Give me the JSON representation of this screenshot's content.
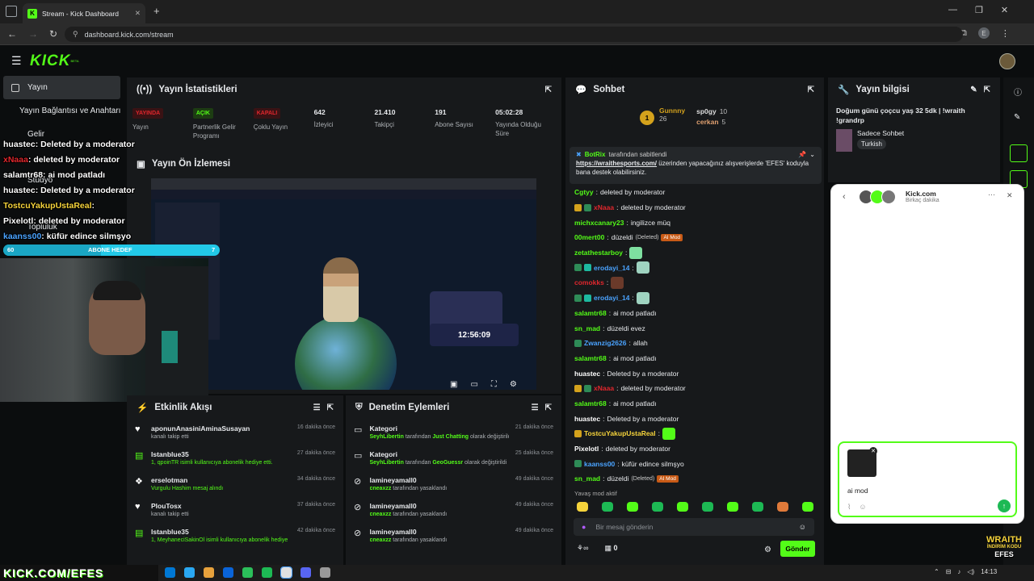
{
  "browser": {
    "tab_title": "Stream - Kick Dashboard",
    "url": "dashboard.kick.com/stream",
    "profile_initial": "E"
  },
  "nav": {
    "logo": "KICK",
    "logo_sup": "BETA"
  },
  "sidebar": {
    "items": [
      {
        "label": "Yayın"
      },
      {
        "label": "Yayın Bağlantısı ve Anahtarı"
      },
      {
        "label": "Gelir"
      },
      {
        "label": "Stüdyo"
      },
      {
        "label": "Topluluk"
      }
    ]
  },
  "stats": {
    "title": "Yayın İstatistikleri",
    "items": [
      {
        "badge": "YAYINDA",
        "label": "Yayın",
        "badge_color": "#e0272d"
      },
      {
        "badge": "AÇIK",
        "label": "Partnerlik Gelir Programı",
        "badge_color": "#53fc18"
      },
      {
        "badge": "KAPALI",
        "label": "Çoklu Yayın",
        "badge_color": "#e0272d"
      },
      {
        "value": "642",
        "label": "İzleyici"
      },
      {
        "value": "21.410",
        "label": "Takipçi"
      },
      {
        "value": "191",
        "label": "Abone Sayısı"
      },
      {
        "value": "05:02:28",
        "label": "Yayında Olduğu Süre"
      }
    ]
  },
  "preview": {
    "title": "Yayın Ön İzlemesi",
    "card_time": "12:56:09",
    "card_title": "Sadece Sohbet"
  },
  "overlay": {
    "lines": [
      {
        "name": "huastec",
        "text": ": Deleted by a moderator"
      },
      {
        "name": "xNaaa",
        "text": ": deleted by moderator"
      },
      {
        "name": "salamtr68",
        "text": ": ai mod patladı"
      },
      {
        "name": "huastec",
        "text": ": Deleted by a moderator"
      },
      {
        "name": "TostcuYakupUstaReal",
        "text": ":"
      },
      {
        "name": "Pixelotl",
        "text": ": deleted by moderator"
      },
      {
        "name": "kaanss00",
        "text": ": küfür edince silmşyo"
      }
    ],
    "goal_left": "60",
    "goal_label": "ABONE HEDEF",
    "goal_right": "7",
    "goal_progress": 0.45,
    "footer_text": "KICK.COM/EFES",
    "wraith_lines": [
      "WRAITH",
      "İNDİRİM KODU",
      "EFES"
    ]
  },
  "activity": {
    "title": "Etkinlik Akışı",
    "items": [
      {
        "icon": "heart-icon",
        "user": "aponunAnasiniAminaSusayan",
        "sub": "kanalı takip etti",
        "time": "16 dakika önce"
      },
      {
        "icon": "gift-icon",
        "user": "Istanblue35",
        "sub": "1, qpoinTR isimli kullanıcıya abonelik hediye etti.",
        "time": "27 dakika önce"
      },
      {
        "icon": "donation-icon",
        "user": "erselotman",
        "sub": "Vurgulu Hashim mesaj alındı",
        "time": "34 dakika önce"
      },
      {
        "icon": "heart-icon",
        "user": "PlouTosx",
        "sub": "kanalı takip etti",
        "time": "37 dakika önce"
      },
      {
        "icon": "gift-icon",
        "user": "Istanblue35",
        "sub": "1, MeyhaneciSakinOl isimli kullanıcıya abonelik hediye etti.",
        "time": "42 dakika önce"
      }
    ]
  },
  "moderation": {
    "title": "Denetim Eylemleri",
    "items": [
      {
        "icon": "category-icon",
        "title": "Kategori",
        "actor": "SeyhLibertin",
        "mid": " tarafından ",
        "target": "Just Chatting",
        "end": " olarak değiştirildi",
        "time": "21 dakika önce"
      },
      {
        "icon": "category-icon",
        "title": "Kategori",
        "actor": "SeyhLibertin",
        "mid": " tarafından ",
        "target": "GeoGuessr",
        "end": " olarak değiştirildi",
        "time": "25 dakika önce"
      },
      {
        "icon": "ban-icon",
        "title": "lamineyamall0",
        "actor": "cneaxzz",
        "mid": " tarafından yasaklandı",
        "target": "",
        "end": "",
        "time": "49 dakika önce"
      },
      {
        "icon": "ban-icon",
        "title": "lamineyamall0",
        "actor": "cneaxzz",
        "mid": " tarafından yasaklandı",
        "target": "",
        "end": "",
        "time": "49 dakika önce"
      },
      {
        "icon": "ban-icon",
        "title": "lamineyamall0",
        "actor": "cneaxzz",
        "mid": " tarafından yasaklandı",
        "target": "",
        "end": "",
        "time": "49 dakika önce"
      }
    ]
  },
  "chat": {
    "title": "Sohbet",
    "leader_first": {
      "rank": "1",
      "name": "Gunnny",
      "count": "26"
    },
    "leader_others": [
      {
        "name": "sp0gy",
        "count": "10"
      },
      {
        "name": "cerkan",
        "count": "5"
      }
    ],
    "pinned": {
      "author": "BotRix",
      "by": "tarafından sabitlendi",
      "link": "https://wraithesports.com/",
      "text": " üzerinden yapacağınız alışverişlerde 'EFES' koduyla bana destek olabilirsiniz."
    },
    "messages": [
      {
        "user": "Cgtyy",
        "color": "#53fc18",
        "text": "deleted by moderator"
      },
      {
        "user": "xNaaa",
        "color": "#e0272d",
        "text": "deleted by moderator",
        "badges": [
          "crown",
          "mod"
        ]
      },
      {
        "user": "michxcanary23",
        "color": "#53fc18",
        "text": "ingilizce müq"
      },
      {
        "user": "00mert00",
        "color": "#53fc18",
        "text": "düzeldi",
        "deleted": "(Deleted)",
        "aimod": "AI Mod"
      },
      {
        "user": "zetathestarboy",
        "color": "#53fc18",
        "text": "",
        "emote": "#7ee0a0"
      },
      {
        "user": "erodayi_14",
        "color": "#4aa3ff",
        "text": "",
        "emote": "#9fd3c0",
        "badges": [
          "mod",
          "sub"
        ]
      },
      {
        "user": "comokks",
        "color": "#e0272d",
        "text": "",
        "emote": "#6b3a2a"
      },
      {
        "user": "erodayi_14",
        "color": "#4aa3ff",
        "text": "",
        "emote": "#9fd3c0",
        "badges": [
          "mod",
          "sub"
        ]
      },
      {
        "user": "salamtr68",
        "color": "#53fc18",
        "text": "ai mod patladı"
      },
      {
        "user": "sn_mad",
        "color": "#53fc18",
        "text": "düzeldi evez"
      },
      {
        "user": "Zwanzig2626",
        "color": "#4aa3ff",
        "text": "allah",
        "badges": [
          "mod"
        ]
      },
      {
        "user": "salamtr68",
        "color": "#53fc18",
        "text": "ai mod patladı"
      },
      {
        "user": "huastec",
        "color": "#ffffff",
        "text": "Deleted by a moderator"
      },
      {
        "user": "xNaaa",
        "color": "#e0272d",
        "text": "deleted by moderator",
        "badges": [
          "crown",
          "mod"
        ]
      },
      {
        "user": "salamtr68",
        "color": "#53fc18",
        "text": "ai mod patladı"
      },
      {
        "user": "huastec",
        "color": "#ffffff",
        "text": "Deleted by a moderator"
      },
      {
        "user": "TostcuYakupUstaReal",
        "color": "#f5d33b",
        "text": "",
        "emote": "#53fc18",
        "badges": [
          "crown"
        ]
      },
      {
        "user": "Pixelotl",
        "color": "#ffffff",
        "text": "deleted by moderator"
      },
      {
        "user": "kaanss00",
        "color": "#4aa3ff",
        "text": "küfür edince silmşyo",
        "badges": [
          "mod"
        ]
      },
      {
        "user": "sn_mad",
        "color": "#53fc18",
        "text": "düzeldi",
        "deleted": "(Deleted)",
        "aimod": "AI Mod"
      }
    ],
    "slow_mode": "Yavaş mod aktif",
    "input_placeholder": "Bir mesaj gönderin",
    "points": "0",
    "send": "Gönder"
  },
  "info": {
    "title": "Yayın bilgisi",
    "stream_title": "Doğum günü çoçcu yaş 32 5dk | !wraith !grandrp",
    "category": "Sadece Sohbet",
    "tag": "Turkish"
  },
  "popup": {
    "title": "Kick.com",
    "subtitle": "Birkaç dakika",
    "input_text": "ai mod"
  },
  "taskbar": {
    "time": "14:13"
  }
}
